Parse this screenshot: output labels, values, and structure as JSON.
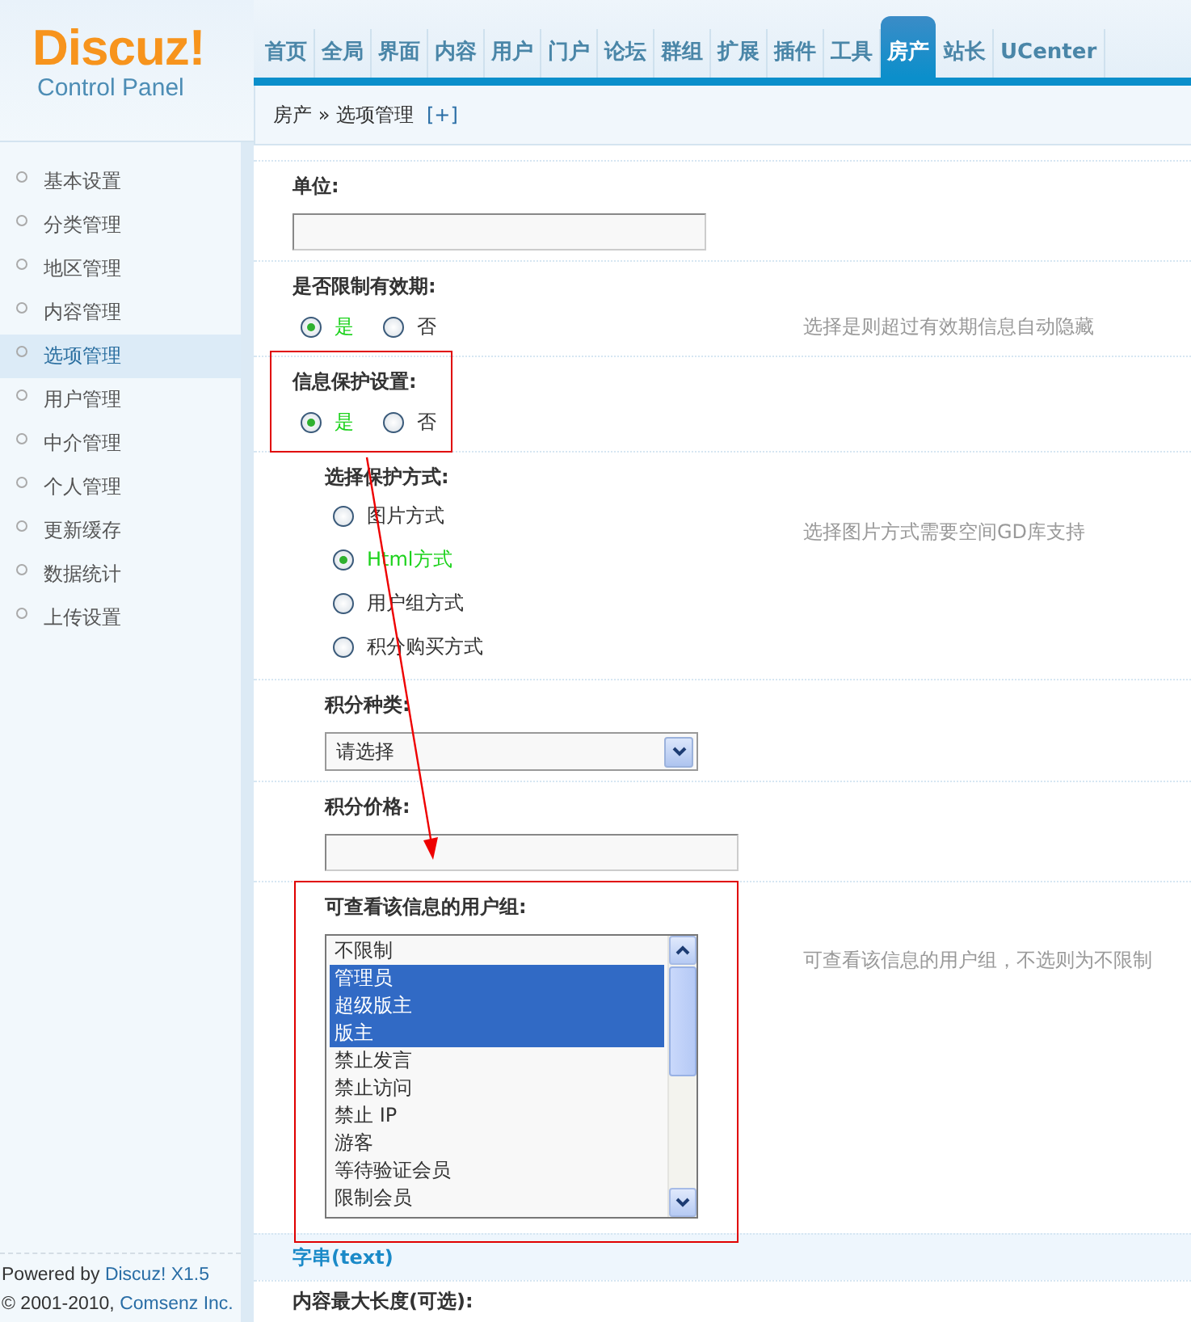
{
  "logo": {
    "brand": "Discuz!",
    "subtitle": "Control Panel"
  },
  "nav": [
    {
      "label": "首页",
      "selected": false
    },
    {
      "label": "全局",
      "selected": false
    },
    {
      "label": "界面",
      "selected": false
    },
    {
      "label": "内容",
      "selected": false
    },
    {
      "label": "用户",
      "selected": false
    },
    {
      "label": "门户",
      "selected": false
    },
    {
      "label": "论坛",
      "selected": false
    },
    {
      "label": "群组",
      "selected": false
    },
    {
      "label": "扩展",
      "selected": false
    },
    {
      "label": "插件",
      "selected": false
    },
    {
      "label": "工具",
      "selected": false
    },
    {
      "label": "房产",
      "selected": true
    },
    {
      "label": "站长",
      "selected": false
    },
    {
      "label": "UCenter",
      "selected": false
    }
  ],
  "breadcrumb": {
    "path": "房产 » 选项管理",
    "add_link": "[+]"
  },
  "sidebar": {
    "items": [
      {
        "label": "基本设置",
        "selected": false
      },
      {
        "label": "分类管理",
        "selected": false
      },
      {
        "label": "地区管理",
        "selected": false
      },
      {
        "label": "内容管理",
        "selected": false
      },
      {
        "label": "选项管理",
        "selected": true
      },
      {
        "label": "用户管理",
        "selected": false
      },
      {
        "label": "中介管理",
        "selected": false
      },
      {
        "label": "个人管理",
        "selected": false
      },
      {
        "label": "更新缓存",
        "selected": false
      },
      {
        "label": "数据统计",
        "selected": false
      },
      {
        "label": "上传设置",
        "selected": false
      }
    ],
    "footer": [
      {
        "text": "Powered by ",
        "link": "Discuz! X1.5"
      },
      {
        "text": "© 2001-2010, ",
        "link": "Comsenz Inc."
      }
    ]
  },
  "form": [
    {
      "kind": "text",
      "label": "单位:",
      "indented": false,
      "highlighted": false
    },
    {
      "kind": "radio",
      "label": "是否限制有效期:",
      "indented": false,
      "highlighted": false,
      "hint": "选择是则超过有效期信息自动隐藏",
      "options": [
        {
          "label": "是",
          "selected": true
        },
        {
          "label": "否",
          "selected": false
        }
      ]
    },
    {
      "kind": "radio",
      "label": "信息保护设置:",
      "indented": false,
      "highlighted": true,
      "options": [
        {
          "label": "是",
          "selected": true
        },
        {
          "label": "否",
          "selected": false
        }
      ]
    },
    {
      "kind": "radio_list",
      "label": "选择保护方式:",
      "indented": true,
      "highlighted": false,
      "hint": "选择图片方式需要空间GD库支持",
      "options": [
        {
          "label": "图片方式",
          "selected": false
        },
        {
          "label": "Html方式",
          "selected": true
        },
        {
          "label": "用户组方式",
          "selected": false
        },
        {
          "label": "积分购买方式",
          "selected": false
        }
      ]
    },
    {
      "kind": "select",
      "label": "积分种类:",
      "indented": true,
      "highlighted": false,
      "value": "请选择"
    },
    {
      "kind": "text",
      "label": "积分价格:",
      "indented": true,
      "highlighted": false
    },
    {
      "kind": "listbox",
      "label": "可查看该信息的用户组:",
      "indented": true,
      "highlighted": true,
      "hint": "可查看该信息的用户组，不选则为不限制",
      "options": [
        {
          "label": "不限制",
          "selected": false
        },
        {
          "label": "管理员",
          "selected": true
        },
        {
          "label": "超级版主",
          "selected": true
        },
        {
          "label": "版主",
          "selected": true
        },
        {
          "label": "禁止发言",
          "selected": false
        },
        {
          "label": "禁止访问",
          "selected": false
        },
        {
          "label": "禁止 IP",
          "selected": false
        },
        {
          "label": "游客",
          "selected": false
        },
        {
          "label": "等待验证会员",
          "selected": false
        },
        {
          "label": "限制会员",
          "selected": false
        }
      ]
    },
    {
      "kind": "section",
      "label": "字串(text)"
    },
    {
      "kind": "label",
      "label": "内容最大长度(可选):",
      "indented": false,
      "highlighted": false
    }
  ],
  "annotation_arrow": true
}
